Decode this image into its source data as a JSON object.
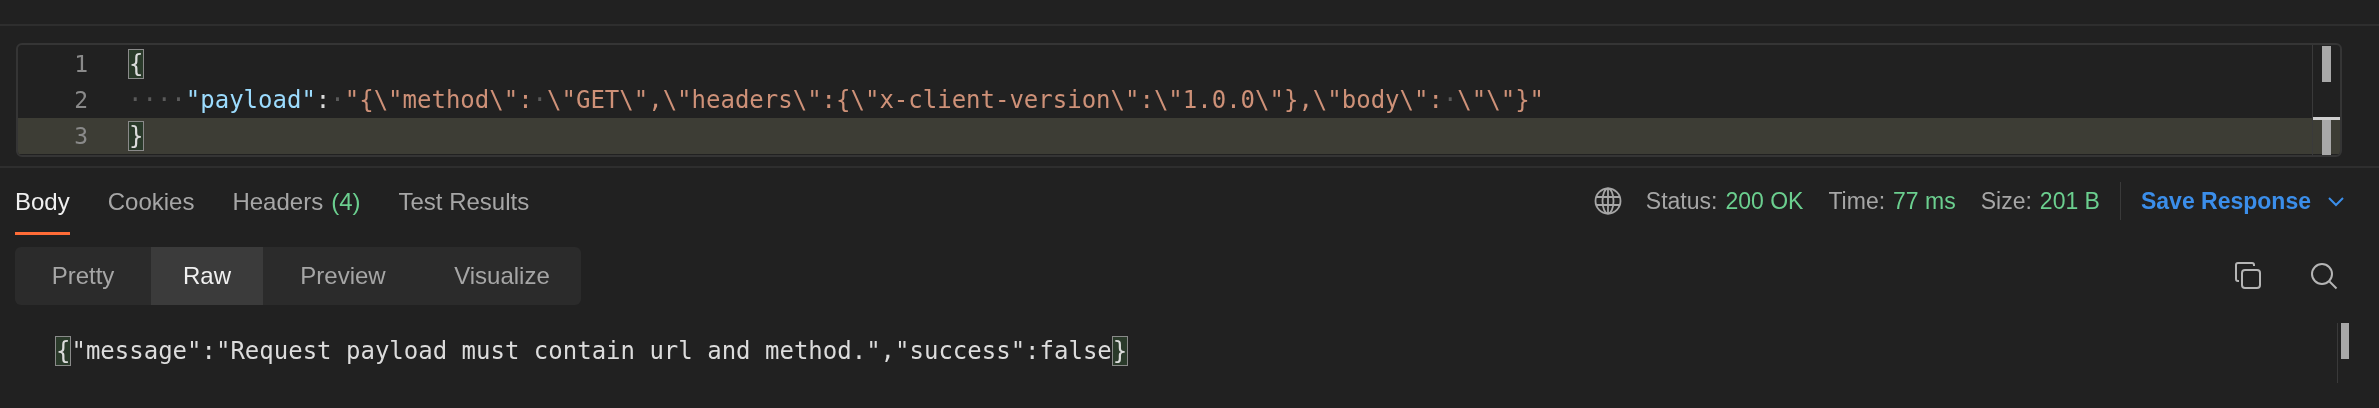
{
  "editor": {
    "lines": [
      {
        "number": "1",
        "current": false,
        "tokens": [
          {
            "kind": "match",
            "text": "{"
          }
        ]
      },
      {
        "number": "2",
        "current": false,
        "tokens": [
          {
            "kind": "space",
            "text": "····"
          },
          {
            "kind": "key",
            "text": "\"payload\""
          },
          {
            "kind": "punct",
            "text": ":"
          },
          {
            "kind": "space",
            "text": "·"
          },
          {
            "kind": "string",
            "text": "\"{\\\"method\\\":"
          },
          {
            "kind": "space",
            "text": "·"
          },
          {
            "kind": "string",
            "text": "\\\"GET\\\",\\\"headers\\\":{\\\"x-client-version\\\":\\\"1.0.0\\\"},\\\"body\\\":"
          },
          {
            "kind": "space",
            "text": "·"
          },
          {
            "kind": "string",
            "text": "\\\"\\\"}\""
          }
        ]
      },
      {
        "number": "3",
        "current": true,
        "tokens": [
          {
            "kind": "match",
            "text": "}"
          }
        ]
      }
    ]
  },
  "response_tabs": [
    {
      "label": "Body",
      "selected": true
    },
    {
      "label": "Cookies",
      "selected": false
    },
    {
      "label": "Headers",
      "count": "(4)",
      "selected": false
    },
    {
      "label": "Test Results",
      "selected": false
    }
  ],
  "meta": [
    {
      "label": "Status:",
      "value": "200 OK"
    },
    {
      "label": "Time:",
      "value": "77 ms"
    },
    {
      "label": "Size:",
      "value": "201 B"
    }
  ],
  "save_button": "Save Response",
  "view_modes": [
    {
      "label": "Pretty",
      "selected": false
    },
    {
      "label": "Raw",
      "selected": true
    },
    {
      "label": "Preview",
      "selected": false
    },
    {
      "label": "Visualize",
      "selected": false
    }
  ],
  "response_body": [
    {
      "kind": "match",
      "text": "{"
    },
    {
      "kind": "text",
      "text": "\"message\":\"Request payload must contain url and method.\",\"success\":false"
    },
    {
      "kind": "match",
      "text": "}"
    }
  ]
}
